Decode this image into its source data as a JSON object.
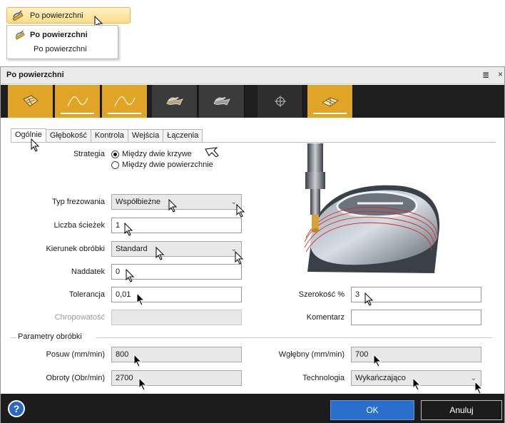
{
  "ribbon": {
    "label": "Po powierzchni"
  },
  "dropdown": {
    "item_bold": "Po powierzchni",
    "item_sub": "Po powierzchni"
  },
  "dialog": {
    "title": "Po powierzchni",
    "tabs": [
      "Ogólnie",
      "Głębokość",
      "Kontrola",
      "Wejścia",
      "Łączenia"
    ],
    "toolbar_icons": [
      "surface-icon",
      "curve-icon",
      "curve-alt-icon",
      "drive-surface-icon",
      "drive-surface-alt-icon",
      "crosshair-icon",
      "plane-icon"
    ]
  },
  "form": {
    "strategia_label": "Strategia",
    "strategia_opt1": "Między dwie krzywe",
    "strategia_opt2": "Między dwie powierzchnie",
    "typ_label": "Typ frezowania",
    "typ_value": "Współbieżne",
    "liczba_label": "Liczba ścieżek",
    "liczba_value": "1",
    "kierunek_label": "Kierunek obróbki",
    "kierunek_value": "Standard",
    "naddatek_label": "Naddatek",
    "naddatek_value": "0",
    "tolerancja_label": "Tolerancja",
    "tolerancja_value": "0,01",
    "chropowatosc_label": "Chropowatość",
    "szerokosc_label": "Szerokość %",
    "szerokosc_value": "3",
    "komentarz_label": "Komentarz",
    "section_title": "Parametry obróbki",
    "posuw_label": "Posuw (mm/min)",
    "posuw_value": "800",
    "wglebny_label": "Wgłębny (mm/min)",
    "wglebny_value": "700",
    "obroty_label": "Obroty (Obr/min)",
    "obroty_value": "2700",
    "technologia_label": "Technologia",
    "technologia_value": "Wykańczająco"
  },
  "buttons": {
    "help": "?",
    "ok": "OK",
    "cancel": "Anuluj"
  },
  "colors": {
    "accent": "#e0a526",
    "ok_blue": "#2a6fce",
    "dark": "#1e1e1e"
  }
}
